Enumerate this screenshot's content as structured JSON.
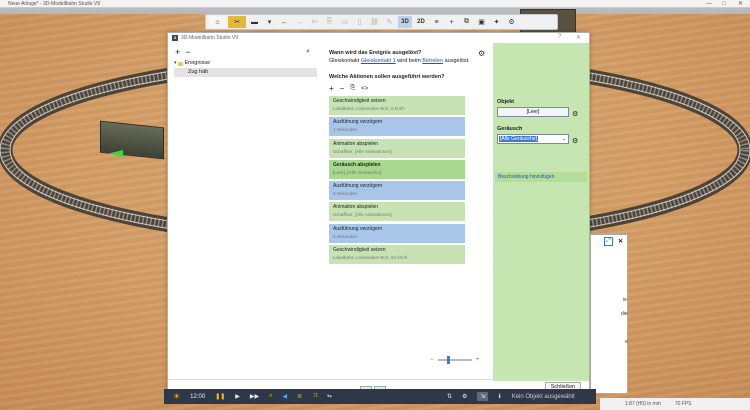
{
  "window": {
    "title": "Neue Anlage* - 3D-Modellbahn Studio V9"
  },
  "toolbar": {
    "items": [
      {
        "icon": "home-icon",
        "glyph": "⌂"
      },
      {
        "icon": "tools-icon",
        "glyph": "✂"
      },
      {
        "icon": "save-icon",
        "glyph": "▬"
      },
      {
        "icon": "dropdown-icon",
        "glyph": "▾"
      },
      {
        "icon": "undo-icon",
        "glyph": "←"
      },
      {
        "icon": "redo-icon",
        "glyph": "→"
      },
      {
        "icon": "cut-icon",
        "glyph": "✄"
      },
      {
        "icon": "copy-icon",
        "glyph": "⎘"
      },
      {
        "icon": "paste-icon",
        "glyph": "▭"
      },
      {
        "icon": "delete-icon",
        "glyph": "▯"
      },
      {
        "icon": "link-icon",
        "glyph": "⛓"
      },
      {
        "icon": "edit-icon",
        "glyph": "✎"
      }
    ],
    "mode_3d": "3D",
    "mode_2d": "2D",
    "right_items": [
      {
        "icon": "layers-icon",
        "glyph": "≡"
      },
      {
        "icon": "add-icon",
        "glyph": "+"
      },
      {
        "icon": "clone-icon",
        "glyph": "⧉"
      },
      {
        "icon": "camera-icon",
        "glyph": "▣"
      },
      {
        "icon": "puzzle-icon",
        "glyph": "✦"
      },
      {
        "icon": "settings-icon",
        "glyph": "⚙"
      }
    ]
  },
  "dialog": {
    "title": "3D-Modellbahn Studio V9",
    "logo": "3",
    "help": "?",
    "tree": {
      "root_label": "Ereignisse",
      "child_label": "Zug hält"
    },
    "event": {
      "question": "Wann wird das Ereignis ausgelöst?",
      "desc_prefix": "Gleiskontakt",
      "desc_link1": "Gleiskontakt 1",
      "desc_middle": "wird beim",
      "desc_link2": "Betreten",
      "desc_suffix": "ausgelöst."
    },
    "actions_title": "Welche Aktionen sollen ausgeführt werden?",
    "actions": [
      {
        "name": "Geschwindigkeit setzen",
        "sub": "Lokalbahn Lokomotive Bn2, 0 km/h",
        "color": "green"
      },
      {
        "name": "Ausführung verzögern",
        "sub": "1 Sekunden",
        "color": "blue"
      },
      {
        "name": "Animation abspielen",
        "sub": "Schaffner, [Alle Animationen]",
        "color": "green"
      },
      {
        "name": "Geräusch abspielen",
        "sub": "[Leer], [Alle Geräusche]",
        "color": "selected"
      },
      {
        "name": "Ausführung verzögern",
        "sub": "5 Sekunden",
        "color": "blue"
      },
      {
        "name": "Animation abspielen",
        "sub": "Schaffner, [Alle Animationen]",
        "color": "green"
      },
      {
        "name": "Ausführung verzögern",
        "sub": "5 Sekunden",
        "color": "blue"
      },
      {
        "name": "Geschwindigkeit setzen",
        "sub": "Lokalbahn Lokomotive Bn2, 50 km/h",
        "color": "green"
      }
    ],
    "props": {
      "object_label": "Objekt",
      "object_value": "[Leer]",
      "sound_label": "Geräusch",
      "sound_value": "[Alle Geräusche]",
      "description_link": "Beschreibung hinzufügen"
    },
    "close_label": "Schließen"
  },
  "side_panel": {
    "text1": "ie",
    "text2": "die",
    "text3": "e"
  },
  "bottombar": {
    "time": "12:00",
    "status": "Kein Objekt ausgewählt"
  },
  "statusbar": {
    "position": "1:87 (H0) in mm",
    "fps": "70 FPS"
  },
  "colors": {
    "action_green": "#c7e3b4",
    "action_blue": "#a8c6ea",
    "action_selected": "#a6d98d",
    "props_bg": "#c5e5b1",
    "toolbar_active": "#e2b93b"
  }
}
